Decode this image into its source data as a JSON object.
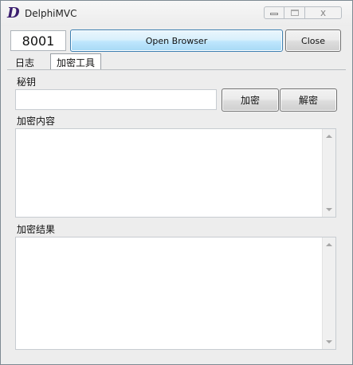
{
  "window": {
    "title": "DelphiMVC",
    "close_glyph": "x",
    "logo_glyph": "D"
  },
  "toolbar": {
    "port": "8001",
    "open_browser_label": "Open Browser",
    "close_label": "Close"
  },
  "tabs": [
    {
      "label": "日志",
      "active": false
    },
    {
      "label": "加密工具",
      "active": true
    }
  ],
  "crypto": {
    "key_label": "秘钥",
    "key_value": "",
    "encrypt_label": "加密",
    "decrypt_label": "解密",
    "content_label": "加密内容",
    "content_value": "",
    "result_label": "加密结果",
    "result_value": ""
  },
  "icons": [
    "app-logo-icon",
    "minimize-icon",
    "maximize-icon",
    "close-icon",
    "scroll-up-icon",
    "scroll-down-icon"
  ]
}
